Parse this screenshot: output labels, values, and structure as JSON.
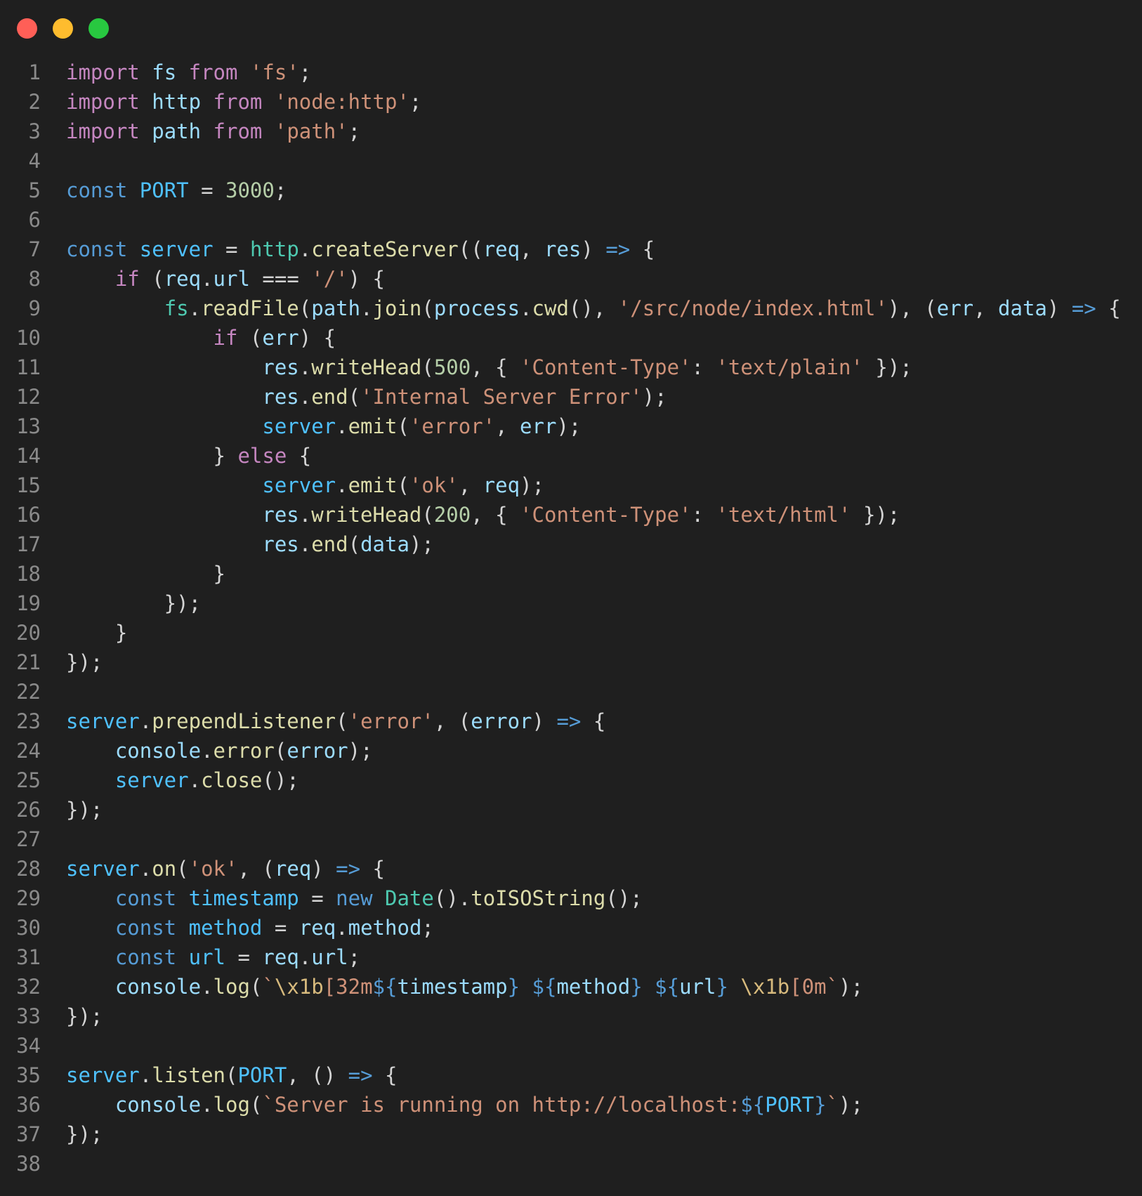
{
  "window": {
    "controls": [
      {
        "name": "close",
        "color": "#ff5f57"
      },
      {
        "name": "minimize",
        "color": "#febc2e"
      },
      {
        "name": "zoom",
        "color": "#28c840"
      }
    ]
  },
  "code": {
    "lines": [
      [
        [
          "kw",
          "import"
        ],
        [
          "pn",
          " "
        ],
        [
          "id",
          "fs"
        ],
        [
          "pn",
          " "
        ],
        [
          "kw",
          "from"
        ],
        [
          "pn",
          " "
        ],
        [
          "str",
          "'fs'"
        ],
        [
          "pn",
          ";"
        ]
      ],
      [
        [
          "kw",
          "import"
        ],
        [
          "pn",
          " "
        ],
        [
          "id",
          "http"
        ],
        [
          "pn",
          " "
        ],
        [
          "kw",
          "from"
        ],
        [
          "pn",
          " "
        ],
        [
          "str",
          "'node:http'"
        ],
        [
          "pn",
          ";"
        ]
      ],
      [
        [
          "kw",
          "import"
        ],
        [
          "pn",
          " "
        ],
        [
          "id",
          "path"
        ],
        [
          "pn",
          " "
        ],
        [
          "kw",
          "from"
        ],
        [
          "pn",
          " "
        ],
        [
          "str",
          "'path'"
        ],
        [
          "pn",
          ";"
        ]
      ],
      [],
      [
        [
          "st",
          "const"
        ],
        [
          "pn",
          " "
        ],
        [
          "cst",
          "PORT"
        ],
        [
          "pn",
          " = "
        ],
        [
          "num",
          "3000"
        ],
        [
          "pn",
          ";"
        ]
      ],
      [],
      [
        [
          "st",
          "const"
        ],
        [
          "pn",
          " "
        ],
        [
          "cst",
          "server"
        ],
        [
          "pn",
          " = "
        ],
        [
          "ty",
          "http"
        ],
        [
          "pn",
          "."
        ],
        [
          "fn",
          "createServer"
        ],
        [
          "pn",
          "(("
        ],
        [
          "id",
          "req"
        ],
        [
          "pn",
          ", "
        ],
        [
          "id",
          "res"
        ],
        [
          "pn",
          ") "
        ],
        [
          "st",
          "=>"
        ],
        [
          "pn",
          " {"
        ]
      ],
      [
        [
          "pn",
          "    "
        ],
        [
          "kw",
          "if"
        ],
        [
          "pn",
          " ("
        ],
        [
          "id",
          "req"
        ],
        [
          "pn",
          "."
        ],
        [
          "id",
          "url"
        ],
        [
          "pn",
          " === "
        ],
        [
          "str",
          "'/'"
        ],
        [
          "pn",
          ") {"
        ]
      ],
      [
        [
          "pn",
          "        "
        ],
        [
          "ty",
          "fs"
        ],
        [
          "pn",
          "."
        ],
        [
          "fn",
          "readFile"
        ],
        [
          "pn",
          "("
        ],
        [
          "id",
          "path"
        ],
        [
          "pn",
          "."
        ],
        [
          "fn",
          "join"
        ],
        [
          "pn",
          "("
        ],
        [
          "id",
          "process"
        ],
        [
          "pn",
          "."
        ],
        [
          "fn",
          "cwd"
        ],
        [
          "pn",
          "(), "
        ],
        [
          "str",
          "'/src/node/index.html'"
        ],
        [
          "pn",
          "), ("
        ],
        [
          "id",
          "err"
        ],
        [
          "pn",
          ", "
        ],
        [
          "id",
          "data"
        ],
        [
          "pn",
          ") "
        ],
        [
          "st",
          "=>"
        ],
        [
          "pn",
          " {"
        ]
      ],
      [
        [
          "pn",
          "            "
        ],
        [
          "kw",
          "if"
        ],
        [
          "pn",
          " ("
        ],
        [
          "id",
          "err"
        ],
        [
          "pn",
          ") {"
        ]
      ],
      [
        [
          "pn",
          "                "
        ],
        [
          "id",
          "res"
        ],
        [
          "pn",
          "."
        ],
        [
          "fn",
          "writeHead"
        ],
        [
          "pn",
          "("
        ],
        [
          "num",
          "500"
        ],
        [
          "pn",
          ", { "
        ],
        [
          "str",
          "'Content-Type'"
        ],
        [
          "pn",
          ": "
        ],
        [
          "str",
          "'text/plain'"
        ],
        [
          "pn",
          " });"
        ]
      ],
      [
        [
          "pn",
          "                "
        ],
        [
          "id",
          "res"
        ],
        [
          "pn",
          "."
        ],
        [
          "fn",
          "end"
        ],
        [
          "pn",
          "("
        ],
        [
          "str",
          "'Internal Server Error'"
        ],
        [
          "pn",
          ");"
        ]
      ],
      [
        [
          "pn",
          "                "
        ],
        [
          "cst",
          "server"
        ],
        [
          "pn",
          "."
        ],
        [
          "fn",
          "emit"
        ],
        [
          "pn",
          "("
        ],
        [
          "str",
          "'error'"
        ],
        [
          "pn",
          ", "
        ],
        [
          "id",
          "err"
        ],
        [
          "pn",
          ");"
        ]
      ],
      [
        [
          "pn",
          "            } "
        ],
        [
          "kw",
          "else"
        ],
        [
          "pn",
          " {"
        ]
      ],
      [
        [
          "pn",
          "                "
        ],
        [
          "cst",
          "server"
        ],
        [
          "pn",
          "."
        ],
        [
          "fn",
          "emit"
        ],
        [
          "pn",
          "("
        ],
        [
          "str",
          "'ok'"
        ],
        [
          "pn",
          ", "
        ],
        [
          "id",
          "req"
        ],
        [
          "pn",
          ");"
        ]
      ],
      [
        [
          "pn",
          "                "
        ],
        [
          "id",
          "res"
        ],
        [
          "pn",
          "."
        ],
        [
          "fn",
          "writeHead"
        ],
        [
          "pn",
          "("
        ],
        [
          "num",
          "200"
        ],
        [
          "pn",
          ", { "
        ],
        [
          "str",
          "'Content-Type'"
        ],
        [
          "pn",
          ": "
        ],
        [
          "str",
          "'text/html'"
        ],
        [
          "pn",
          " });"
        ]
      ],
      [
        [
          "pn",
          "                "
        ],
        [
          "id",
          "res"
        ],
        [
          "pn",
          "."
        ],
        [
          "fn",
          "end"
        ],
        [
          "pn",
          "("
        ],
        [
          "id",
          "data"
        ],
        [
          "pn",
          ");"
        ]
      ],
      [
        [
          "pn",
          "            }"
        ]
      ],
      [
        [
          "pn",
          "        });"
        ]
      ],
      [
        [
          "pn",
          "    }"
        ]
      ],
      [
        [
          "pn",
          "});"
        ]
      ],
      [],
      [
        [
          "cst",
          "server"
        ],
        [
          "pn",
          "."
        ],
        [
          "fn",
          "prependListener"
        ],
        [
          "pn",
          "("
        ],
        [
          "str",
          "'error'"
        ],
        [
          "pn",
          ", ("
        ],
        [
          "id",
          "error"
        ],
        [
          "pn",
          ") "
        ],
        [
          "st",
          "=>"
        ],
        [
          "pn",
          " {"
        ]
      ],
      [
        [
          "pn",
          "    "
        ],
        [
          "id",
          "console"
        ],
        [
          "pn",
          "."
        ],
        [
          "fn",
          "error"
        ],
        [
          "pn",
          "("
        ],
        [
          "id",
          "error"
        ],
        [
          "pn",
          ");"
        ]
      ],
      [
        [
          "pn",
          "    "
        ],
        [
          "cst",
          "server"
        ],
        [
          "pn",
          "."
        ],
        [
          "fn",
          "close"
        ],
        [
          "pn",
          "();"
        ]
      ],
      [
        [
          "pn",
          "});"
        ]
      ],
      [],
      [
        [
          "cst",
          "server"
        ],
        [
          "pn",
          "."
        ],
        [
          "fn",
          "on"
        ],
        [
          "pn",
          "("
        ],
        [
          "str",
          "'ok'"
        ],
        [
          "pn",
          ", ("
        ],
        [
          "id",
          "req"
        ],
        [
          "pn",
          ") "
        ],
        [
          "st",
          "=>"
        ],
        [
          "pn",
          " {"
        ]
      ],
      [
        [
          "pn",
          "    "
        ],
        [
          "st",
          "const"
        ],
        [
          "pn",
          " "
        ],
        [
          "cst",
          "timestamp"
        ],
        [
          "pn",
          " = "
        ],
        [
          "st",
          "new"
        ],
        [
          "pn",
          " "
        ],
        [
          "ty",
          "Date"
        ],
        [
          "pn",
          "()."
        ],
        [
          "fn",
          "toISOString"
        ],
        [
          "pn",
          "();"
        ]
      ],
      [
        [
          "pn",
          "    "
        ],
        [
          "st",
          "const"
        ],
        [
          "pn",
          " "
        ],
        [
          "cst",
          "method"
        ],
        [
          "pn",
          " = "
        ],
        [
          "id",
          "req"
        ],
        [
          "pn",
          "."
        ],
        [
          "id",
          "method"
        ],
        [
          "pn",
          ";"
        ]
      ],
      [
        [
          "pn",
          "    "
        ],
        [
          "st",
          "const"
        ],
        [
          "pn",
          " "
        ],
        [
          "cst",
          "url"
        ],
        [
          "pn",
          " = "
        ],
        [
          "id",
          "req"
        ],
        [
          "pn",
          "."
        ],
        [
          "id",
          "url"
        ],
        [
          "pn",
          ";"
        ]
      ],
      [
        [
          "pn",
          "    "
        ],
        [
          "id",
          "console"
        ],
        [
          "pn",
          "."
        ],
        [
          "fn",
          "log"
        ],
        [
          "pn",
          "("
        ],
        [
          "str",
          "`"
        ],
        [
          "es",
          "\\x1b"
        ],
        [
          "str",
          "[32m"
        ],
        [
          "st",
          "${"
        ],
        [
          "id",
          "timestamp"
        ],
        [
          "st",
          "}"
        ],
        [
          "str",
          " "
        ],
        [
          "st",
          "${"
        ],
        [
          "id",
          "method"
        ],
        [
          "st",
          "}"
        ],
        [
          "str",
          " "
        ],
        [
          "st",
          "${"
        ],
        [
          "id",
          "url"
        ],
        [
          "st",
          "}"
        ],
        [
          "str",
          " "
        ],
        [
          "es",
          "\\x1b"
        ],
        [
          "str",
          "[0m`"
        ],
        [
          "pn",
          ");"
        ]
      ],
      [
        [
          "pn",
          "});"
        ]
      ],
      [],
      [
        [
          "cst",
          "server"
        ],
        [
          "pn",
          "."
        ],
        [
          "fn",
          "listen"
        ],
        [
          "pn",
          "("
        ],
        [
          "cst",
          "PORT"
        ],
        [
          "pn",
          ", () "
        ],
        [
          "st",
          "=>"
        ],
        [
          "pn",
          " {"
        ]
      ],
      [
        [
          "pn",
          "    "
        ],
        [
          "id",
          "console"
        ],
        [
          "pn",
          "."
        ],
        [
          "fn",
          "log"
        ],
        [
          "pn",
          "("
        ],
        [
          "str",
          "`Server is running on http://localhost:"
        ],
        [
          "st",
          "${"
        ],
        [
          "cst",
          "PORT"
        ],
        [
          "st",
          "}"
        ],
        [
          "str",
          "`"
        ],
        [
          "pn",
          ");"
        ]
      ],
      [
        [
          "pn",
          "});"
        ]
      ],
      []
    ]
  }
}
